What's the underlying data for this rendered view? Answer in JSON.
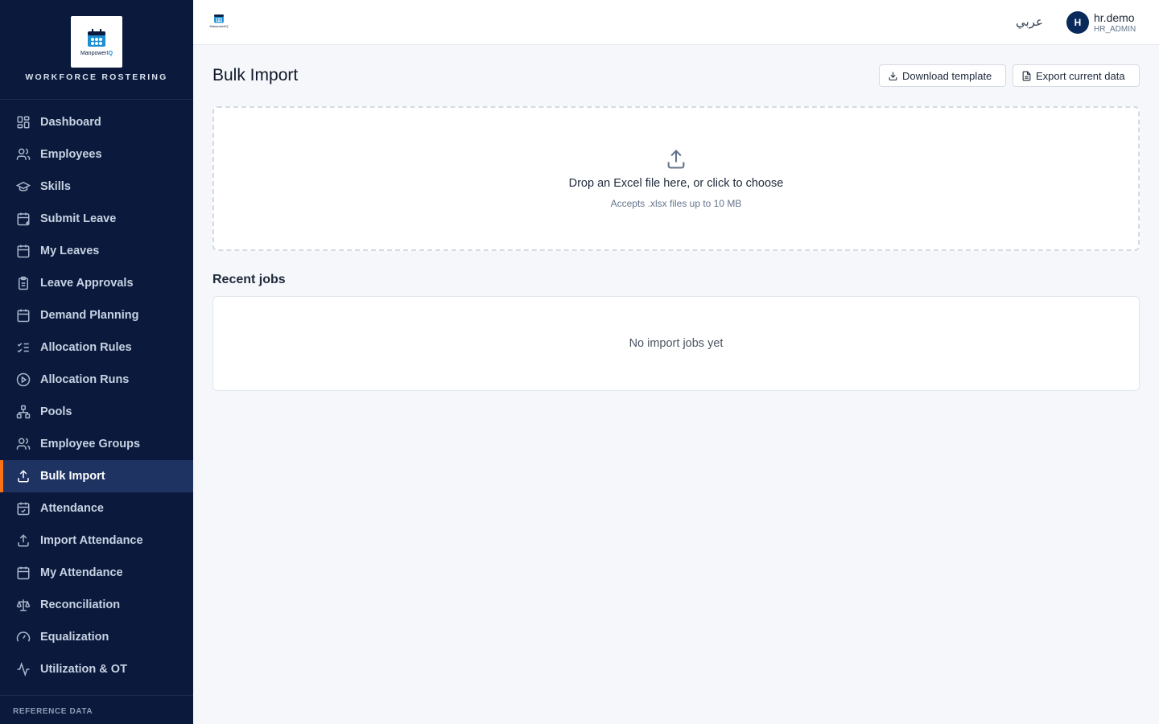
{
  "brand": {
    "logo_name": "Manpower",
    "logo_suffix": "IQ",
    "subtitle": "WORKFORCE ROSTERING"
  },
  "sidebar": {
    "items": [
      {
        "label": "Dashboard",
        "icon": "dashboard-icon",
        "active": false
      },
      {
        "label": "Employees",
        "icon": "users-icon",
        "active": false
      },
      {
        "label": "Skills",
        "icon": "graduation-cap-icon",
        "active": false
      },
      {
        "label": "Submit Leave",
        "icon": "calendar-plus-icon",
        "active": false
      },
      {
        "label": "My Leaves",
        "icon": "calendar-icon",
        "active": false
      },
      {
        "label": "Leave Approvals",
        "icon": "clipboard-check-icon",
        "active": false
      },
      {
        "label": "Demand Planning",
        "icon": "calendar-grid-icon",
        "active": false
      },
      {
        "label": "Allocation Rules",
        "icon": "list-checks-icon",
        "active": false
      },
      {
        "label": "Allocation Runs",
        "icon": "play-circle-icon",
        "active": false
      },
      {
        "label": "Pools",
        "icon": "network-icon",
        "active": false
      },
      {
        "label": "Employee Groups",
        "icon": "users-icon",
        "active": false
      },
      {
        "label": "Bulk Import",
        "icon": "upload-icon",
        "active": true
      },
      {
        "label": "Attendance",
        "icon": "calendar-check-icon",
        "active": false
      },
      {
        "label": "Import Attendance",
        "icon": "upload-icon",
        "active": false
      },
      {
        "label": "My Attendance",
        "icon": "calendar-grid-icon",
        "active": false
      },
      {
        "label": "Reconciliation",
        "icon": "scale-icon",
        "active": false
      },
      {
        "label": "Equalization",
        "icon": "gauge-icon",
        "active": false
      },
      {
        "label": "Utilization & OT",
        "icon": "activity-icon",
        "active": false
      }
    ],
    "reference_section": "REFERENCE DATA"
  },
  "topbar": {
    "language_toggle": "عربي",
    "user": {
      "avatar_initial": "H",
      "name": "hr.demo",
      "role": "HR_ADMIN"
    }
  },
  "main": {
    "title": "Bulk Import",
    "buttons": {
      "download_template": "Download template",
      "export_current": "Export current data"
    },
    "dropzone": {
      "title": "Drop an Excel file here, or click to choose",
      "hint": "Accepts .xlsx files up to 10 MB"
    },
    "recent_jobs": {
      "title": "Recent jobs",
      "empty_text": "No import jobs yet"
    }
  },
  "colors": {
    "sidebar_bg": "#0b1a3c",
    "active_item_bg": "#1e3362",
    "active_accent": "#f97316",
    "page_bg": "#f5f7fa"
  }
}
